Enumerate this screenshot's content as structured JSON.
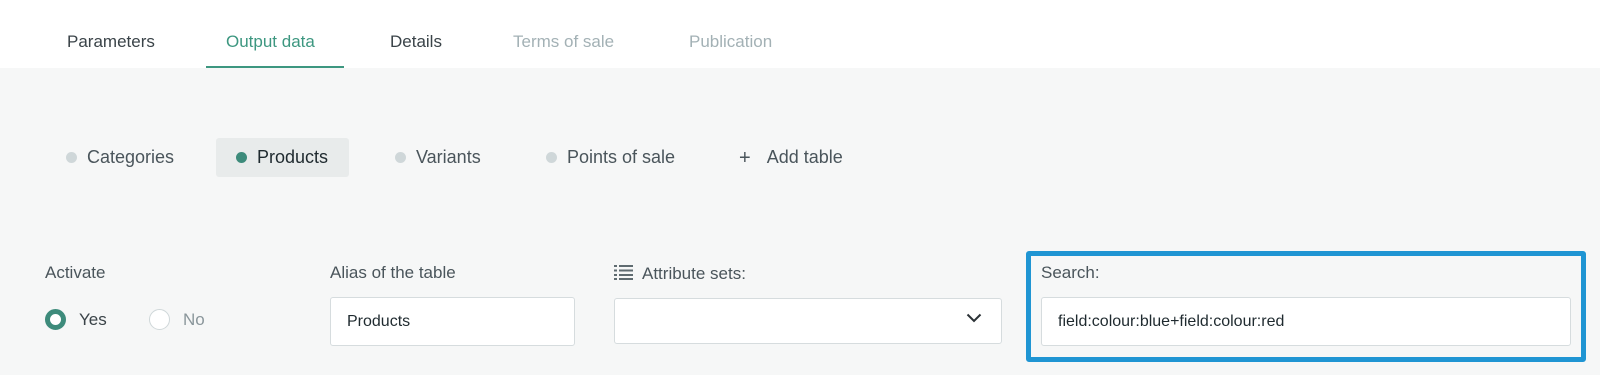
{
  "tabs": {
    "parameters": "Parameters",
    "output_data": "Output data",
    "details": "Details",
    "terms_of_sale": "Terms of sale",
    "publication": "Publication"
  },
  "tables": {
    "categories": "Categories",
    "products": "Products",
    "variants": "Variants",
    "points_of_sale": "Points of sale",
    "add_table": "Add table",
    "add_symbol": "+"
  },
  "form": {
    "activate_label": "Activate",
    "yes_label": "Yes",
    "no_label": "No",
    "activate_value": "Yes",
    "alias_label": "Alias of the table",
    "alias_value": "Products",
    "attribute_sets_label": "Attribute sets:",
    "attribute_sets_value": "",
    "search_label": "Search:",
    "search_value": "field:colour:blue+field:colour:red"
  },
  "colors": {
    "accent": "#3d9780",
    "highlight_border": "#1f95d3",
    "background": "#f6f7f7"
  },
  "icons": {
    "attribute_sets": "list-icon",
    "dropdown": "chevron-down-icon"
  }
}
